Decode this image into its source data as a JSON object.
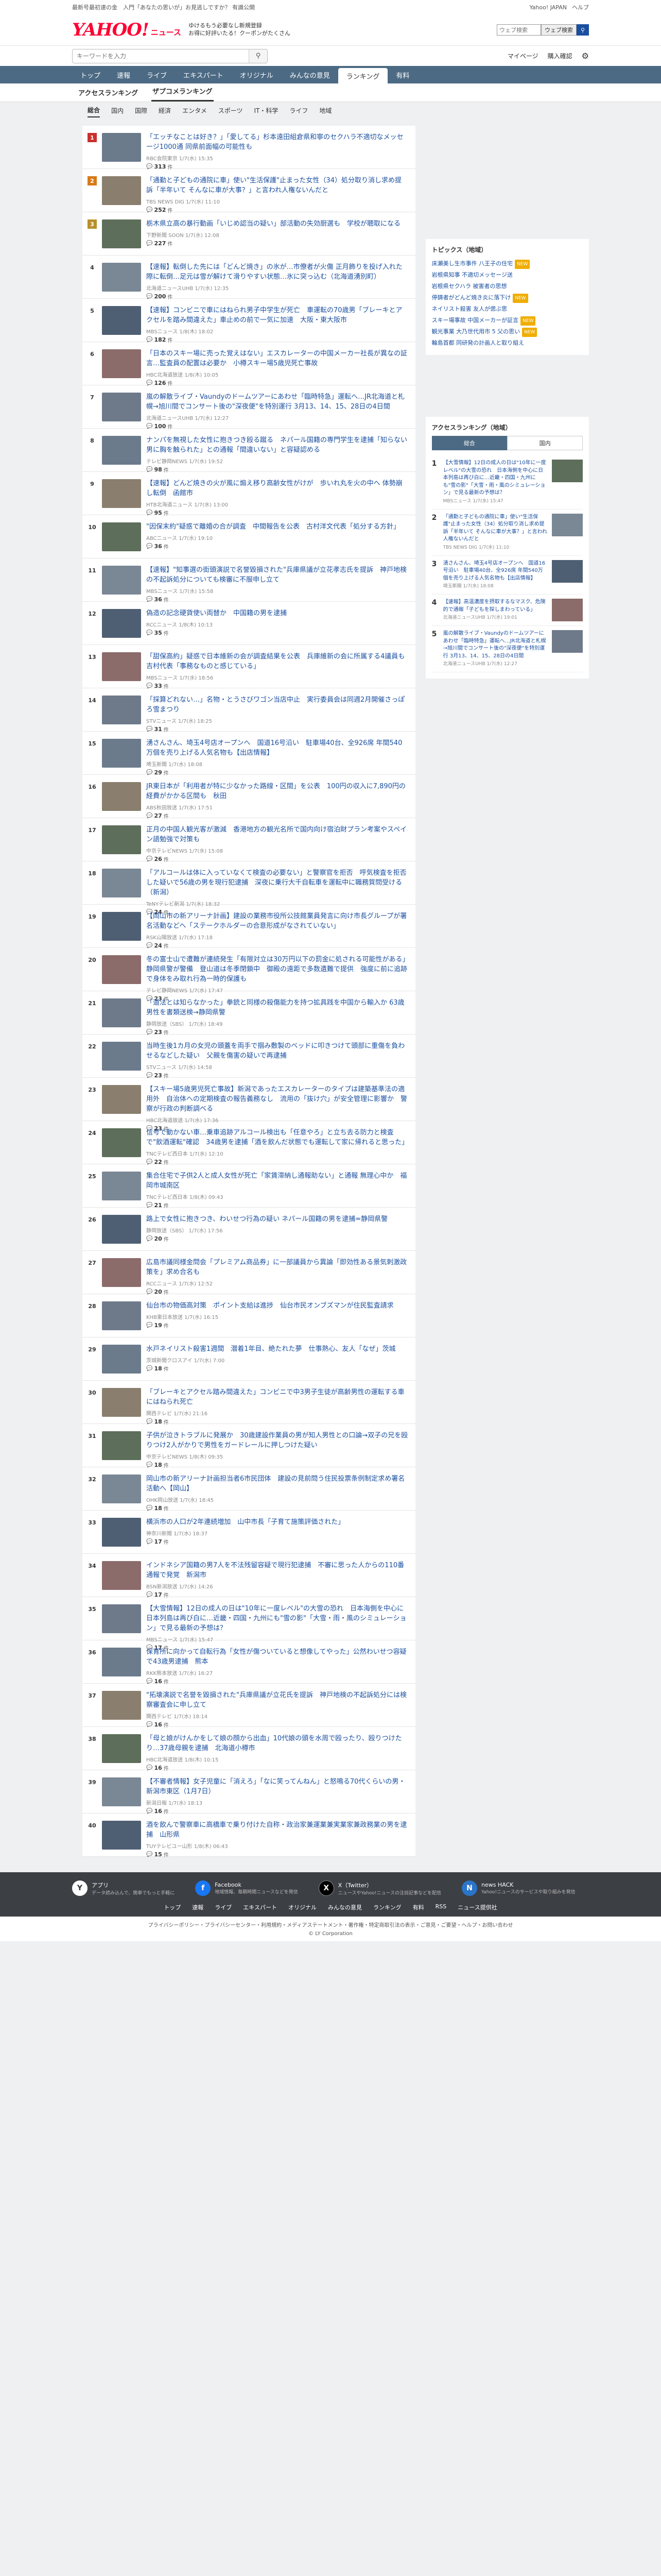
{
  "topbar": {
    "left": "最新号最初速の金　入門「あなたの思いが」お見逃しですか？ 有識公開",
    "links": [
      "Yahoo! JAPAN",
      "ヘルプ"
    ],
    "search_placeholder": "ウェブ検索",
    "search_button": "ウェブ検索"
  },
  "header": {
    "logo": "YAHOO!",
    "logo_sub": "ニュース",
    "promo_line1": "ゆけるもう必要なし新規登録",
    "promo_line2": "お得に好評いたる！クーポンがたくさん"
  },
  "searchbar": {
    "placeholder": "キーワードを入力",
    "links": [
      "マイページ",
      "購入確認"
    ]
  },
  "nav": [
    "トップ",
    "速報",
    "ライブ",
    "エキスパート",
    "オリジナル",
    "みんなの意見",
    "ランキング",
    "有料"
  ],
  "nav_active": "ランキング",
  "subtabs": [
    "アクセスランキング",
    "ザプコメランキング"
  ],
  "subtab_active": "ザプコメランキング",
  "cattabs": [
    "総合",
    "国内",
    "国際",
    "経済",
    "エンタメ",
    "スポーツ",
    "IT・科学",
    "ライフ",
    "地域"
  ],
  "cattab_active": "総合",
  "items": [
    {
      "rank": "1",
      "title": "「エッチなことは好き？」「愛してる」杉本遠田組倉県和寧のセクハラ不適切なメッセージ1000通 同県前面幅の可能性も",
      "source": "RBC会院東京 1/7(水) 15:35",
      "count": "313"
    },
    {
      "rank": "2",
      "title": "「通勤と子どもの通院に車」使い\"生活保護\"止まった女性（34）処分取り消し求め提訴「半年いて そんなに車が大事？」と言われ人権ないんだと",
      "source": "TBS NEWS DIG 1/7(水) 11:10",
      "count": "252"
    },
    {
      "rank": "3",
      "title": "栃木県立高の暴行動画「いじめ認当の疑い」部活動の失効厨選も　学校が聴取になる",
      "source": "下野新聞 SOON 1/7(水) 12:08",
      "count": "227"
    },
    {
      "rank": "4",
      "title": "【速報】転倒した先には「どんど焼き」の氷が…市僚者が火傷 正月飾りを投げ入れた際に転倒…足元は雪が解けて滑りやすい状態…氷に突っ込む（北海道湧別町）",
      "source": "北海道ニュースUHB 1/7(水) 12:35",
      "count": "200"
    },
    {
      "rank": "5",
      "title": "【速報】コンビニで車にはねられ男子中学生が死亡　車運転の70歳男「ブレーキとアクセルを踏み間違えた」車止めの前で一気に加速　大阪・東大阪市",
      "source": "MBSニュース 1/8(木) 18:02",
      "count": "182"
    },
    {
      "rank": "6",
      "title": "「日本のスキー場に売った覚えはない」エスカレーターの中国メーカー社長が異なの証言…監査員の配置は必要か　小樽スキー場5歳児死亡事故",
      "source": "HBC北海道放送 1/8(木) 10:05",
      "count": "126"
    },
    {
      "rank": "7",
      "title": "嵐の解散ライブ・Vaundyのドームツアーにあわせ「臨時特急」運転へ…JR北海道と札幌→旭川間でコンサート後の\"深夜便\"を特別運行 3月13、14、15、28日の4日間",
      "source": "北海道ニュースUHB 1/7(水) 12:27",
      "count": "100"
    },
    {
      "rank": "8",
      "title": "ナンパを無視した女性に抱きつき殴る蹴る　ネパール国籍の専門学生を逮捕「知らない男に胸を触られた」との通報「間違いない」と容疑認める",
      "source": "テレビ静岡NEWS 1/7(水) 19:52",
      "count": "98"
    },
    {
      "rank": "9",
      "title": "【速報】どんど焼きの火が風に煽え移り高齢女性がけが　歩いれ丸を火の中へ 体勢崩し転倒　函館市",
      "source": "HTB北海道ニュース 1/7(水) 13:00",
      "count": "95"
    },
    {
      "rank": "10",
      "title": "\"因保末約\"疑惑で離婚の合が調査　中間報告を公表　古村洋文代表「処分する方針」",
      "source": "ABCニュース 1/7(水) 19:10",
      "count": "36"
    },
    {
      "rank": "11",
      "title": "【速報】\"知事選の街頭演説で名誉毀損された\"兵庫県議が立花孝志氏を提訴　神戸地検の不起訴処分についても検審に不服申し立て",
      "source": "MBSニュース 1/7(水) 15:58",
      "count": "36"
    },
    {
      "rank": "12",
      "title": "偽造の記念硬貨使い両替か　中国籍の男を逮捕",
      "source": "RCCニュース 1/8(木) 10:13",
      "count": "35"
    },
    {
      "rank": "13",
      "title": "「甜保高約」疑惑で日本維新の会が調査結果を公表　兵庫維新の会に所属する4議員も　吉村代表「事務なものと感じている」",
      "source": "MBSニュース 1/7(水) 18:56",
      "count": "33"
    },
    {
      "rank": "14",
      "title": "「採算どれない…」名物・とうさびワゴン当店中止　実行委員会は同週2月開催さっぽろ雪まつり",
      "source": "STVニュース 1/7(水) 18:25",
      "count": "31"
    },
    {
      "rank": "15",
      "title": "湧さんさん、埼玉4号店オープンへ　国道16号沿い　駐車場40台、全926席 年間540万個を売り上げる人気名物も【出店情報】",
      "source": "埼玉新聞 1/7(水) 18:08",
      "count": "29"
    },
    {
      "rank": "16",
      "title": "JR東日本が「利用者が特に少なかった路線・区間」を公表　100円の収入に7,890円の経費がかかる区間も　秋田",
      "source": "ABS秋田放送 1/7(水) 17:51",
      "count": "27"
    },
    {
      "rank": "17",
      "title": "正月の中国人観光客が激減　香港地方の観光名所で国内向け宿泊財プラン考案やスペイン語勉強で対策も",
      "source": "中京テレビNEWS 1/7(水) 15:08",
      "count": "26"
    },
    {
      "rank": "18",
      "title": "「アルコールは体に入っていなくて検査の必要ない」と警察官を拒否　呼気検査を拒否した疑いで56歳の男を現行犯逮捕　深夜に乗行大千自転車を運転中に職務質問受ける（新潟）",
      "source": "TeNYテレビ新潟 1/7(水) 18:32",
      "count": "24"
    },
    {
      "rank": "19",
      "title": "【岡山市の新アリーナ計画】建設の業務市役所公技館業員発言に向け市長グループが署名活動などへ「ステークホルダーの合意形成がなされていない」",
      "source": "RSK山陽放送 1/7(水) 17:18",
      "count": "24"
    },
    {
      "rank": "20",
      "title": "冬の富士山で遭難が連続発生「有限対立は30万円以下の罰金に処される可能性がある」静岡県警が警備　登山道は冬季閉鎖中　御殿の遠距で多数遺難で提供　強度に前に追跡で身体をみ取れ行為一時的保護も",
      "source": "テレビ静岡NEWS 1/7(水) 17:47",
      "count": "23"
    },
    {
      "rank": "21",
      "title": "「道法とは知らなかった」拳銃と同様の殺傷能力を持つ拡具践を中国から輸入か 63歳男性を書類送検→静岡県警",
      "source": "静岡放送（SBS） 1/7(水) 18:49",
      "count": "23"
    },
    {
      "rank": "22",
      "title": "当時生後1カ月の女児の頭蓋を両手で掴み敷製のベッドに叩きつけて頭部に重傷を負わせるなどした疑い　父親を傷害の疑いで再逮捕",
      "source": "STVニュース 1/7(水) 14:58",
      "count": "23"
    },
    {
      "rank": "23",
      "title": "【スキー場5歳男児死亡事故】新潟であったエスカレーターのタイプは建築基準法の適用外　自治体への定期検査の報告義務なし　流用の「抜け穴」が安全管理に影響か　警察が行政の判断調べる",
      "source": "HBC北海道放送 1/7(水) 17:36",
      "count": "23"
    },
    {
      "rank": "24",
      "title": "信号で動かない車…乗車追跡アルコール検出も「任意やろ」と立ち去る防力と検査で\"飲酒運転\"確認　34歳男を逮捕「酒を飲んだ状態でも運転して家に帰れると思った」",
      "source": "TNCテレビ西日本 1/7(水) 12:10",
      "count": "22"
    },
    {
      "rank": "25",
      "title": "集合住宅で子供2人と成人女性が死亡「家賃滞納し通報助ない」と通報 無理心中か　福岡市城南区",
      "source": "TNCテレビ西日本 1/8(木) 09:43",
      "count": "21"
    },
    {
      "rank": "26",
      "title": "路上で女性に抱きつき、わいせつ行為の疑い ネパール国籍の男を逮捕=静岡県警",
      "source": "静岡放送（SBS） 1/7(水) 17:56",
      "count": "20"
    },
    {
      "rank": "27",
      "title": "広島市議同様金問会「プレミアム商品券」に一部議員から異論「即効性ある景気刺激政策を」求め合名も",
      "source": "RCCニュース 1/7(水) 12:52",
      "count": "20"
    },
    {
      "rank": "28",
      "title": "仙台市の物価高対策　ポイント支給は進捗　仙台市民オンブズマンが住民監査請求",
      "source": "KHB東日本放送 1/7(水) 16:15",
      "count": "19"
    },
    {
      "rank": "29",
      "title": "水戸ネイリスト殺害1週間　潜着1年目、絶たれた夢　仕事熱心、友人「なぜ」茨城",
      "source": "茨城新聞クロスアイ 1/7(水) 7:00",
      "count": "18"
    },
    {
      "rank": "30",
      "title": "「ブレーキとアクセル踏み間違えた」コンビニで中3男子生徒が高齢男性の運転する車にはねられ死亡",
      "source": "関西テレビ 1/7(水) 21:16",
      "count": "18"
    },
    {
      "rank": "31",
      "title": "子供が泣きトラブルに発展か　30歳建設作業員の男が知人男性との口論→双子の兄を殴りつけ2人がかりで男性をガードレールに押しつけた疑い",
      "source": "中京テレビNEWS 1/8(木) 09:35",
      "count": "18"
    },
    {
      "rank": "32",
      "title": "岡山市の新アリーナ計画担当者6市民団体　建設の見前問う住民投票条例制定求め署名活動へ【岡山】",
      "source": "OHK岡山放送 1/7(水) 18:45",
      "count": "18"
    },
    {
      "rank": "33",
      "title": "横浜市の人口が2年連続増加　山中市長「子育て施策評価された」",
      "source": "神奈川新聞 1/7(水) 18:37",
      "count": "17"
    },
    {
      "rank": "34",
      "title": "インドネシア国籍の男7人を不法残留容疑で現行犯逮捕　不審に思った人からの110番通報で発覚　新潟市",
      "source": "BSN新潟放送 1/7(水) 14:26",
      "count": "17"
    },
    {
      "rank": "35",
      "title": "【大雪情報】12日の成人の日は\"10年に一度レベル\"の大雪の恐れ　日本海側を中心に日本列島は再び白に…近畿・四国・九州にも\"雪の影\"「大雪・雨・風のシミュレーション」で見る最新の予想は？",
      "source": "MBSニュース 1/7(水) 15:47",
      "count": "17"
    },
    {
      "rank": "36",
      "title": "保育所に向かって自転行為「女性が傷ついていると想像してやった」公然わいせつ容疑で43歳男逮捕　熊本",
      "source": "RKK熊本放送 1/7(水) 16:27",
      "count": "16"
    },
    {
      "rank": "37",
      "title": "\"拓壊演説で名誉を毀損された\"兵庫県議が立花氏を提訴　神戸地検の不起訴処分には検察審査会に申し立て",
      "source": "関西テレビ 1/7(水) 18:14",
      "count": "16"
    },
    {
      "rank": "38",
      "title": "「母と娘がけんかをして娘の顔から出血」10代娘の頭を水周で殴ったり、殴りつけたり…37歳母親を逮捕　北海道小樽市",
      "source": "HBC北海道放送 1/8(木) 10:15",
      "count": "16"
    },
    {
      "rank": "39",
      "title": "【不審者情報】女子児童に「消えろ」「なに笑ってんねん」と怒鳴る70代くらいの男・新潟市東区（1月7日）",
      "source": "新潟日報 1/7(水) 18:13",
      "count": "16"
    },
    {
      "rank": "40",
      "title": "酒を飲んで警察車に高橋車で乗り付けた自称・政治家兼運業兼実業家兼政務業の男を逮捕　山形県",
      "source": "TUYテレビユー山形 1/8(木) 06:43",
      "count": "15"
    }
  ],
  "comment_suffix": "件",
  "side": {
    "topics_title": "トピックス（地域）",
    "topics": [
      {
        "text": "床瀬美し生市事件 八王子の住宅",
        "tag": "NEW"
      },
      {
        "text": "岩根県知事 不適切メッセージ送",
        "tag": ""
      },
      {
        "text": "岩根県セクハラ 被害者の思想",
        "tag": ""
      },
      {
        "text": "停鋳者がどんど焼き炎に落下け",
        "tag": "NEW"
      },
      {
        "text": "ネイリスト殺害 友人が偲ぶ思",
        "tag": ""
      },
      {
        "text": "スキー場事故 中国メーカーが証言",
        "tag": "NEW"
      },
      {
        "text": "観光事業 大乃世代用市 5 父の思い",
        "tag": "NEW"
      },
      {
        "text": "輪島首都 同研発の計画人と取り組え",
        "tag": ""
      }
    ],
    "access_title": "アクセスランキング（地域）",
    "access_tabs": [
      "総合",
      "国内"
    ],
    "access": [
      {
        "n": "1",
        "text": "【大雪情報】12日の成人の日は\"10年に一度レベル\"の大雪の恐れ　日本海側を中心に日本列島は再び白に…近畿・四国・九州にも\"雪の影\"「大雪・雨・風のシミュレーション」で見る最新の予想は？",
        "src": "MBSニュース 1/7(水) 15:47"
      },
      {
        "n": "2",
        "text": "「通勤と子どもの通院に車」使い\"生活保護\"止まった女性（34）処分取り消し求め提訴「半年いて そんなに車が大事？」と言われ人権ないんだと",
        "src": "TBS NEWS DIG 1/7(水) 11:10"
      },
      {
        "n": "3",
        "text": "湧さんさん、埼玉4号店オープンへ　国道16号沿い　駐車場40台、全926席 年間540万個を売り上げる人気名物も【出店情報】",
        "src": "埼玉新聞 1/7(水) 18:08"
      },
      {
        "n": "4",
        "text": "【速報】高温濃度を摂取するなマスク、危険的で通報「子どもを探しまわっている」",
        "src": "北海道ニュースUHB 1/7(水) 19:01"
      },
      {
        "n": "5",
        "text": "嵐の解散ライブ・Vaundyのドームツアーにあわせ「臨時特急」運転へ…JR北海道と札幌→旭川間でコンサート後の\"深夜便\"を特別運行 3月13、14、15、28日の4日間",
        "src": "北海道ニュースUHB 1/7(水) 12:27"
      }
    ]
  },
  "footer": {
    "apps": [
      {
        "name": "アプリ",
        "sub": "データ読み込んで、簡単でもっと手軽に",
        "icon": "Y"
      },
      {
        "name": "Facebook",
        "sub": "地域情報、毎朝時間ニュースなどを発信",
        "icon": "f"
      },
      {
        "name": "X（Twitter）",
        "sub": "ニュースやYahoo!ニュースの注目記事などを配信",
        "icon": "X"
      },
      {
        "name": "news HACK",
        "sub": "Yahoo!ニュースのサービスや取り組みを発信",
        "icon": "N"
      }
    ],
    "nav": [
      "トップ",
      "速報",
      "ライブ",
      "エキスパート",
      "オリジナル",
      "みんなの意見",
      "ランキング",
      "有料",
      "RSS",
      "ニュース提供社"
    ],
    "legal": "プライバシーポリシー・プライバシーセンター・利用規約・メディアステートメント・著作権・特定商取引法の表示・ご意見・ご要望・ヘルプ・お問い合わせ",
    "copyright": "© LY Corporation"
  }
}
